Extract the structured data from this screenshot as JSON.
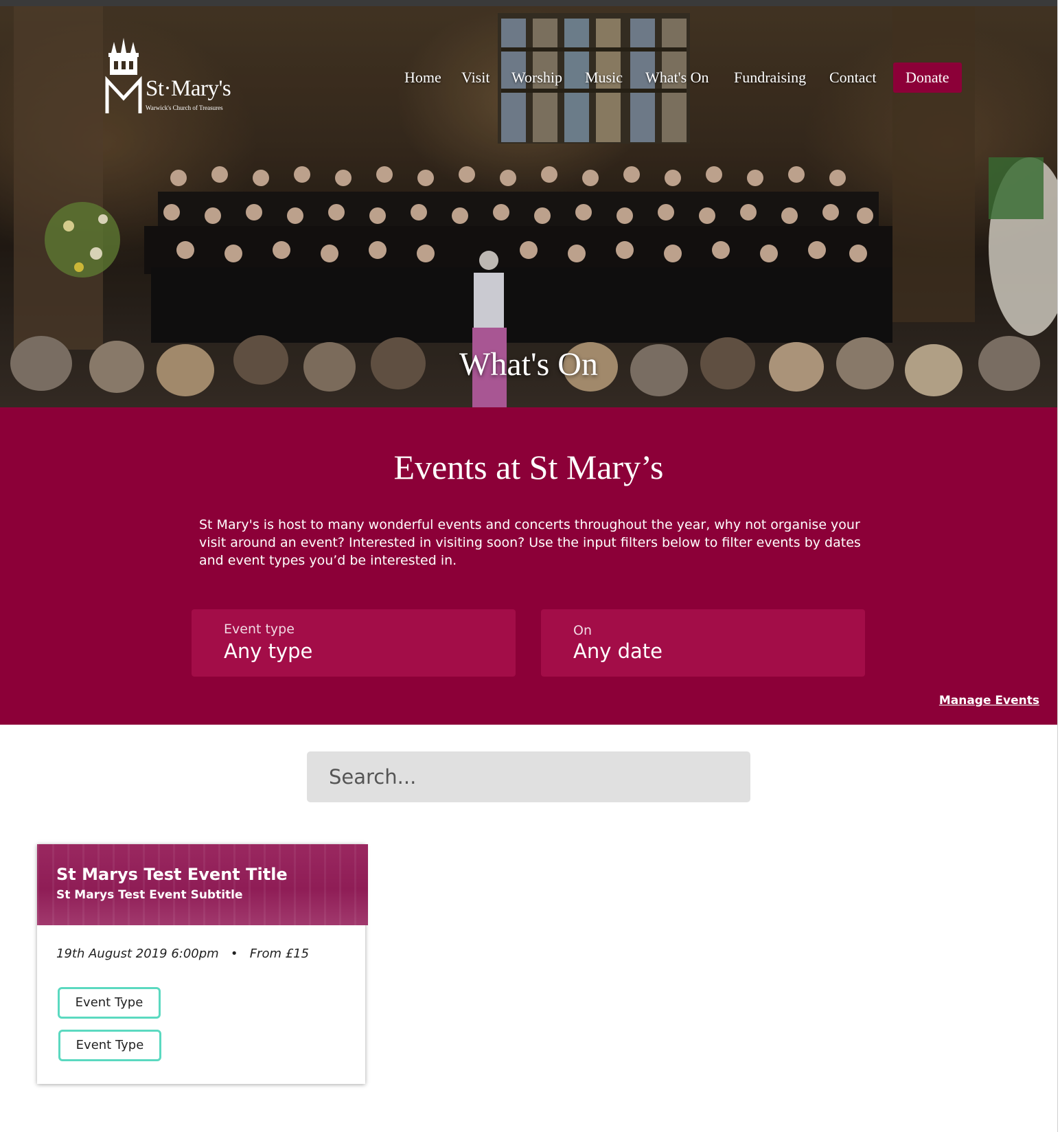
{
  "logo": {
    "name": "St·Mary's",
    "tagline": "Warwick's Church of Treasures"
  },
  "nav": {
    "items": [
      "Home",
      "Visit",
      "Worship",
      "Music",
      "What's On",
      "Fundraising",
      "Contact"
    ],
    "donate_label": "Donate"
  },
  "hero": {
    "title": "What's On"
  },
  "events_section": {
    "heading": "Events at St Mary’s",
    "description": "St Mary's is host to many wonderful events and concerts throughout the year, why not organise your visit around an event? Interested in visiting soon? Use the input filters below to filter events by dates and event types you’d be interested in.",
    "filters": [
      {
        "label": "Event type",
        "value": "Any type"
      },
      {
        "label": "On",
        "value": "Any date"
      }
    ],
    "manage_link": "Manage Events"
  },
  "search": {
    "placeholder": "Search..."
  },
  "event_card": {
    "title": "St Marys Test Event Title",
    "subtitle": "St Marys Test Event Subtitle",
    "date": "19th August 2019 6:00pm",
    "separator": "•",
    "price": "From £15",
    "tags": [
      "Event Type",
      "Event Type"
    ]
  },
  "colors": {
    "brand_maroon": "#8c0038",
    "filter_bg": "#a30d48",
    "tag_border": "#5bd9c0"
  }
}
